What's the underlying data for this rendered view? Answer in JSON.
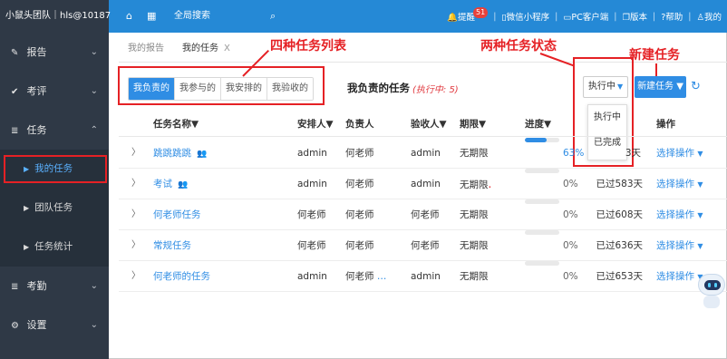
{
  "topbar": {
    "brand": "小鼠头团队｜hls@10187",
    "search": "全局搜索",
    "right": [
      {
        "icon": "bell-icon",
        "label": "提醒",
        "badge": "51"
      },
      {
        "icon": "mobile-icon",
        "label": "微信小程序"
      },
      {
        "icon": "monitor-icon",
        "label": "PC客户端"
      },
      {
        "icon": "copy-icon",
        "label": "版本"
      },
      {
        "icon": "help-icon",
        "label": "帮助"
      },
      {
        "icon": "user-icon",
        "label": "我的"
      }
    ]
  },
  "sidebar": {
    "items": [
      {
        "label": "报告",
        "icon": "edit-icon",
        "chevron": "down"
      },
      {
        "label": "考评",
        "icon": "check-icon",
        "chevron": "down"
      },
      {
        "label": "任务",
        "icon": "list-icon",
        "chevron": "up"
      },
      {
        "label": "考勤",
        "icon": "list-icon",
        "chevron": "down"
      },
      {
        "label": "设置",
        "icon": "gear-icon",
        "chevron": "down"
      }
    ],
    "subitems": [
      {
        "label": "我的任务",
        "active": true
      },
      {
        "label": "团队任务",
        "active": false
      },
      {
        "label": "任务统计",
        "active": false
      }
    ]
  },
  "tabs": [
    {
      "label": "我的报告",
      "current": false
    },
    {
      "label": "我的任务",
      "current": true,
      "close": "X"
    }
  ],
  "filters": [
    {
      "label": "我负责的",
      "on": true
    },
    {
      "label": "我参与的",
      "on": false
    },
    {
      "label": "我安排的",
      "on": false
    },
    {
      "label": "我验收的",
      "on": false
    }
  ],
  "section": {
    "title": "我负责的任务",
    "subtitle": "(执行中: 5)"
  },
  "status_select": {
    "value": "执行中",
    "options": [
      "执行中",
      "已完成"
    ]
  },
  "new_button": "新建任务",
  "annotations": {
    "filters": "四种任务列表",
    "status": "两种任务状态",
    "new": "新建任务"
  },
  "table": {
    "headers": {
      "name": "任务名称▼",
      "arranger": "安排人▼",
      "owner": "负责人",
      "acceptor": "验收人▼",
      "deadline": "期限▼",
      "progress": "进度▼",
      "ops": "操作"
    },
    "rows": [
      {
        "name": "跳跳跳跳",
        "people_icon": true,
        "arranger": "admin",
        "owner": "何老师",
        "acceptor": "admin",
        "deadline": "无期限",
        "progress": 0.63,
        "progress_text": "63%",
        "overdue": "3天",
        "op": "选择操作"
      },
      {
        "name": "考试",
        "people_icon": true,
        "arranger": "admin",
        "owner": "何老师",
        "acceptor": "admin",
        "deadline": "无期限",
        "progress": 0,
        "progress_text": "0%",
        "overdue": "已过583天",
        "op": "选择操作"
      },
      {
        "name": "何老师任务",
        "people_icon": false,
        "arranger": "何老师",
        "owner": "何老师",
        "acceptor": "何老师",
        "deadline": "无期限",
        "progress": 0,
        "progress_text": "0%",
        "overdue": "已过608天",
        "op": "选择操作"
      },
      {
        "name": "常规任务",
        "people_icon": false,
        "arranger": "何老师",
        "owner": "何老师",
        "acceptor": "何老师",
        "deadline": "无期限",
        "progress": 0,
        "progress_text": "0%",
        "overdue": "已过636天",
        "op": "选择操作"
      },
      {
        "name": "何老师的任务",
        "people_icon": false,
        "arranger": "admin",
        "owner": "何老师",
        "owner_more": "…",
        "acceptor": "admin",
        "deadline": "无期限",
        "progress": 0,
        "progress_text": "0%",
        "overdue": "已过653天",
        "op": "选择操作"
      }
    ]
  }
}
